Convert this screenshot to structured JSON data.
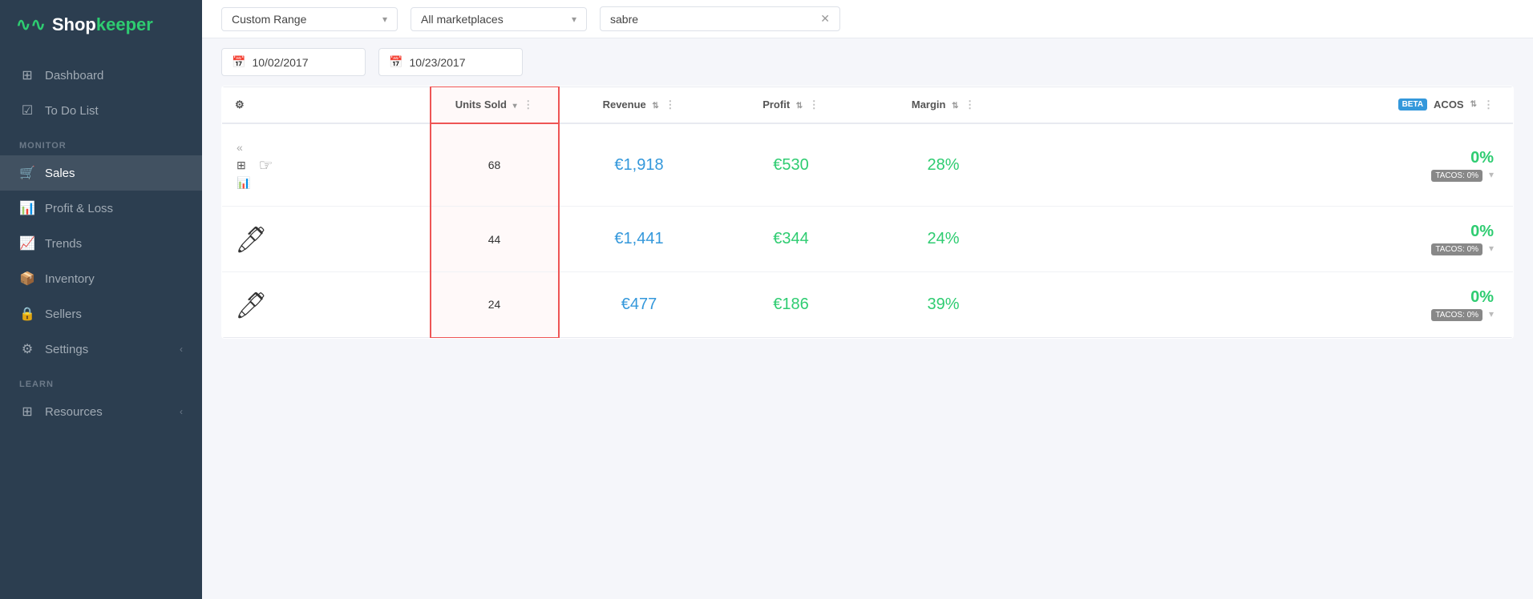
{
  "sidebar": {
    "logo": {
      "icon": "∿",
      "text_plain": "Shop",
      "text_accent": "keeper"
    },
    "sections": [
      {
        "items": [
          {
            "id": "dashboard",
            "label": "Dashboard",
            "icon": "⊞",
            "active": false
          },
          {
            "id": "todo",
            "label": "To Do List",
            "icon": "☑",
            "active": false
          }
        ]
      },
      {
        "label": "MONITOR",
        "items": [
          {
            "id": "sales",
            "label": "Sales",
            "icon": "🛒",
            "active": true
          },
          {
            "id": "profitloss",
            "label": "Profit & Loss",
            "icon": "📊",
            "active": false
          },
          {
            "id": "trends",
            "label": "Trends",
            "icon": "📈",
            "active": false
          }
        ]
      },
      {
        "items": [
          {
            "id": "inventory",
            "label": "Inventory",
            "icon": "📦",
            "active": false
          },
          {
            "id": "sellers",
            "label": "Sellers",
            "icon": "🔒",
            "active": false
          },
          {
            "id": "settings",
            "label": "Settings",
            "icon": "⚙",
            "active": false
          }
        ]
      },
      {
        "label": "LEARN",
        "items": [
          {
            "id": "resources",
            "label": "Resources",
            "icon": "⊞",
            "active": false
          }
        ]
      }
    ]
  },
  "filters": {
    "range_label": "Custom Range",
    "range_chevron": "▾",
    "marketplace_label": "All marketplaces",
    "marketplace_chevron": "▾",
    "search_value": "sabre",
    "search_close": "✕"
  },
  "dates": {
    "start": "10/02/2017",
    "end": "10/23/2017"
  },
  "table": {
    "columns": [
      {
        "id": "settings",
        "label": ""
      },
      {
        "id": "units_sold",
        "label": "Units Sold",
        "sortable": true
      },
      {
        "id": "revenue",
        "label": "Revenue",
        "sortable": true
      },
      {
        "id": "profit",
        "label": "Profit",
        "sortable": true
      },
      {
        "id": "margin",
        "label": "Margin",
        "sortable": true
      },
      {
        "id": "acos",
        "label": "ACOS",
        "sortable": true,
        "beta": true
      }
    ],
    "rows": [
      {
        "id": 1,
        "product_icon": "",
        "has_views": true,
        "has_cursor": true,
        "units_sold": "68",
        "revenue": "€1,918",
        "profit": "€530",
        "margin": "28%",
        "acos": "0%",
        "tacos": "TACOS: 0%"
      },
      {
        "id": 2,
        "product_icon": "🖊",
        "has_views": false,
        "has_cursor": false,
        "units_sold": "44",
        "revenue": "€1,441",
        "profit": "€344",
        "margin": "24%",
        "acos": "0%",
        "tacos": "TACOS: 0%"
      },
      {
        "id": 3,
        "product_icon": "🖊",
        "has_views": false,
        "has_cursor": false,
        "units_sold": "24",
        "revenue": "€477",
        "profit": "€186",
        "margin": "39%",
        "acos": "0%",
        "tacos": "TACOS: 0%"
      }
    ]
  },
  "icons": {
    "calendar": "📅",
    "gear": "⚙",
    "sort_up_down": "⇅",
    "col_menu": "⋮",
    "chevron_down": "▾",
    "view_collapse": "«",
    "view_grid": "⊞",
    "view_chart": "📊"
  }
}
